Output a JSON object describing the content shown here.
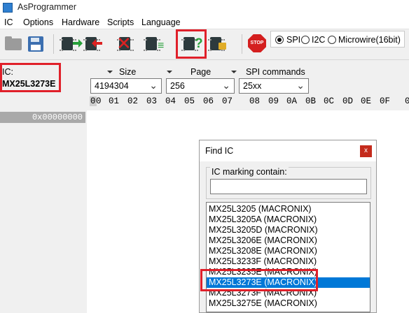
{
  "window": {
    "title": "AsProgrammer"
  },
  "menu": [
    "IC",
    "Options",
    "Hardware",
    "Scripts",
    "Language"
  ],
  "toolbar": {
    "stop_label": "STOP"
  },
  "protocol": {
    "options": [
      "SPI",
      "I2C",
      "Microwire(16bit)"
    ],
    "selected": "SPI"
  },
  "ic": {
    "label": "IC:",
    "value": "MX25L3273E"
  },
  "size": {
    "label": "Size",
    "value": "4194304"
  },
  "page": {
    "label": "Page",
    "value": "256"
  },
  "spi_commands": {
    "label": "SPI commands",
    "value": "25xx"
  },
  "hex": {
    "columns": [
      "0",
      "0",
      "01",
      "02",
      "03",
      "04",
      "05",
      "06",
      "07",
      "08",
      "09",
      "0A",
      "0B",
      "0C",
      "0D",
      "0E",
      "0F",
      "0"
    ],
    "address": "0x00000000"
  },
  "find_ic": {
    "title": "Find IC",
    "close_glyph": "x",
    "marking_label": "IC marking contain:",
    "marking_value": "",
    "results": [
      "MX25L3205 (MACRONIX)",
      "MX25L3205A (MACRONIX)",
      "MX25L3205D (MACRONIX)",
      "MX25L3206E (MACRONIX)",
      "MX25L3208E (MACRONIX)",
      "MX25L3233F (MACRONIX)",
      "MX25L3235E (MACRONIX)",
      "MX25L3273E (MACRONIX)",
      "MX25L3273F (MACRONIX)",
      "MX25L3275E (MACRONIX)"
    ],
    "selected": "MX25L3273E (MACRONIX)"
  },
  "colors": {
    "highlight": "#e0202a",
    "selection": "#0078d7",
    "stop": "#d41f1f",
    "accent_green": "#27a03a"
  }
}
